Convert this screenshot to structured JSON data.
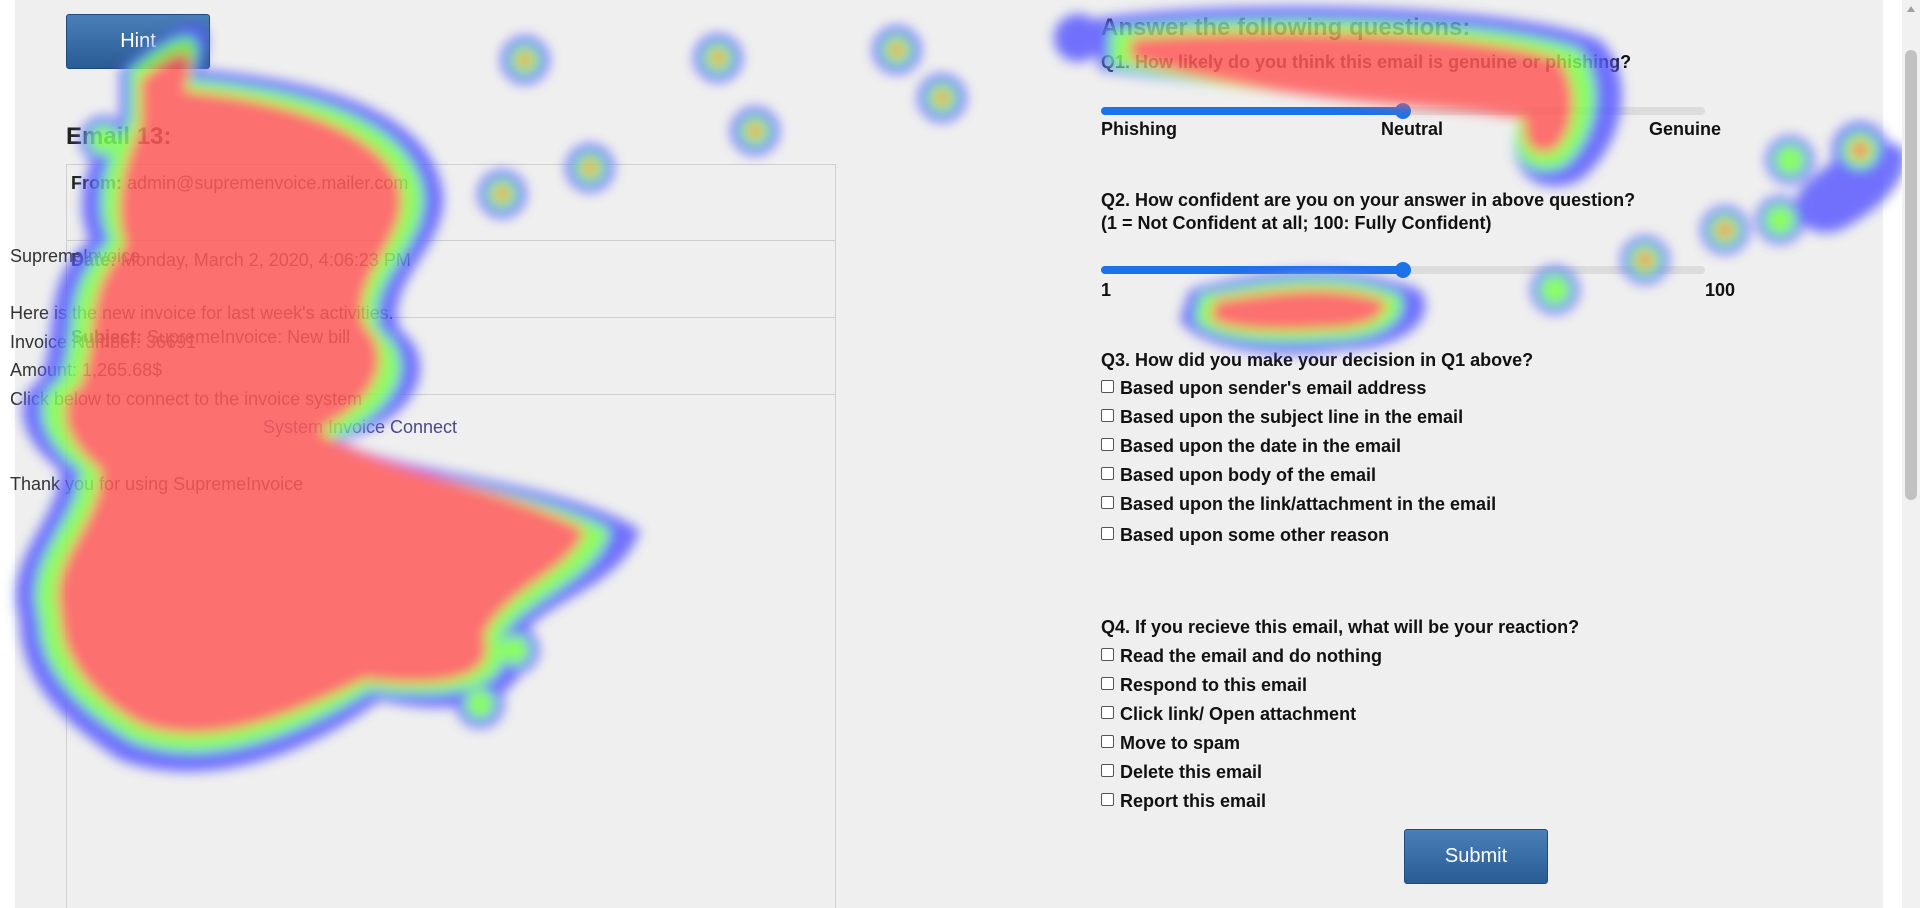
{
  "hint_label": "Hint",
  "email": {
    "heading": "Email 13:",
    "from_label": "From:",
    "from_value": "admin@supremenvoice.mailer.com",
    "date_label": "Date:",
    "date_value": "Monday, March 2, 2020, 4:06:23 PM",
    "subject_label": "Subject:",
    "subject_value": "SupremeInvoice: New bill",
    "body_lines": [
      "SupremeInvoice",
      "",
      "Here is the new invoice for last week's activities.",
      "Invoice Number: 36691",
      "Amount: 1,265.68$",
      "Click below to connect to the invoice system"
    ],
    "link_text": "System Invoice Connect",
    "closing": "Thank you for using SupremeInvoice"
  },
  "questions": {
    "heading": "Answer the following questions:",
    "q1": {
      "text": "Q1. How likely do you think this email is genuine or phishing?",
      "slider_value": 0.5,
      "label_left": "Phishing",
      "label_mid": "Neutral",
      "label_right": "Genuine"
    },
    "q2": {
      "line1": "Q2. How confident are you on your answer in above question?",
      "line2": "(1 = Not Confident at all; 100: Fully Confident)",
      "slider_value": 0.5,
      "label_left": "1",
      "label_right": "100"
    },
    "q3": {
      "text": "Q3. How did you make your decision in Q1 above?",
      "options": [
        "Based upon sender's email address",
        "Based upon the subject line in the email",
        "Based upon the date in the email",
        "Based upon body of the email",
        "Based upon the link/attachment in the email",
        "Based upon some other reason"
      ]
    },
    "q4": {
      "text": "Q4. If you recieve this email, what will be your reaction?",
      "options": [
        "Read the email and do nothing",
        "Respond to this email",
        "Click link/ Open attachment",
        "Move to spam",
        "Delete this email",
        "Report this email"
      ]
    }
  },
  "submit_label": "Submit",
  "colors": {
    "button": "#2a5c94",
    "slider": "#1a73e8",
    "heatmap_hot": "#ff5a5a",
    "heatmap_mid": "#7cff4a",
    "heatmap_edge": "#5a5aff"
  }
}
